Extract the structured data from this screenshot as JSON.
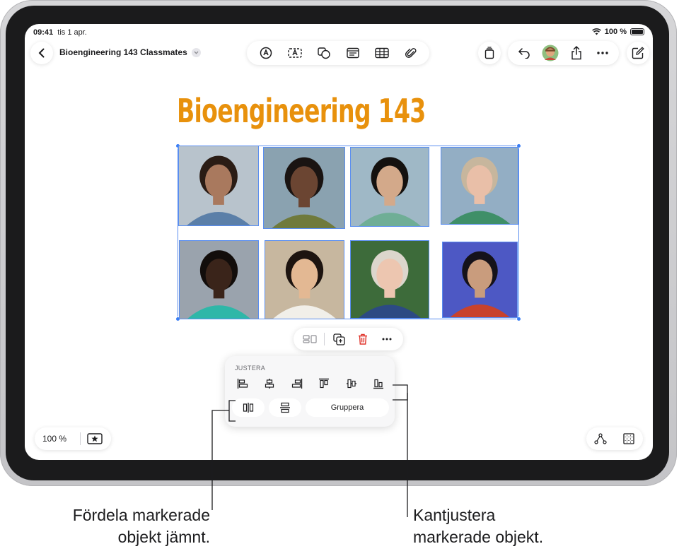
{
  "status": {
    "time": "09:41",
    "date": "tis 1 apr.",
    "battery": "100 %"
  },
  "toolbar": {
    "document_title": "Bioengineering 143 Classmates"
  },
  "canvas": {
    "heading": "Bioengineering 143"
  },
  "align_panel": {
    "header": "JUSTERA",
    "group_label": "Gruppera"
  },
  "zoom": {
    "value": "100 %"
  },
  "callouts": {
    "left": [
      "Fördela markerade",
      "objekt jämnt."
    ],
    "right": [
      "Kantjustera",
      "markerade objekt."
    ]
  },
  "photos": [
    {
      "skin": "#a9795e",
      "hair": "#2a1c15",
      "shirt": "#5b7fa8",
      "bg": "#b8c3cc"
    },
    {
      "skin": "#6b4532",
      "hair": "#1a1412",
      "shirt": "#6f7a3c",
      "bg": "#8aa2b0"
    },
    {
      "skin": "#d3a98a",
      "hair": "#14110f",
      "shirt": "#6fae96",
      "bg": "#9fb8c6"
    },
    {
      "skin": "#e9bfa8",
      "hair": "#c7b69d",
      "shirt": "#3f8f68",
      "bg": "#93aec4"
    },
    {
      "skin": "#3a241a",
      "hair": "#120d0b",
      "shirt": "#2fb7a8",
      "bg": "#9aa3ad"
    },
    {
      "skin": "#e3b893",
      "hair": "#1d1410",
      "shirt": "#f1efe9",
      "bg": "#c7b79f"
    },
    {
      "skin": "#edc6b0",
      "hair": "#dcd6cc",
      "shirt": "#2c4a83",
      "bg": "#3d6b3a"
    },
    {
      "skin": "#c99c7d",
      "hair": "#15121a",
      "shirt": "#c8422c",
      "bg": "#4d58c4"
    }
  ],
  "colors": {
    "accent": "#e8910c",
    "selection": "#3a7ef5",
    "delete": "#e0342b"
  }
}
